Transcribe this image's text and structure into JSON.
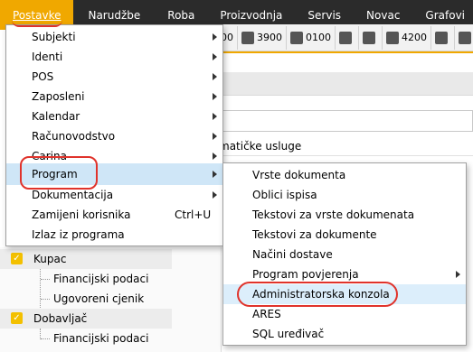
{
  "menubar": {
    "items": [
      {
        "label": "Postavke"
      },
      {
        "label": "Narudžbe"
      },
      {
        "label": "Roba"
      },
      {
        "label": "Proizvodnja"
      },
      {
        "label": "Servis"
      },
      {
        "label": "Novac"
      },
      {
        "label": "Grafovi"
      }
    ]
  },
  "toolbar": {
    "items": [
      {
        "label": "00"
      },
      {
        "label": "3900"
      },
      {
        "label": "0100"
      },
      {
        "label": "4200"
      }
    ]
  },
  "background": {
    "field_text": "matičke usluge"
  },
  "tree": {
    "kupac": "Kupac",
    "kupac_children": [
      "Financijski podaci",
      "Ugovoreni cjenik"
    ],
    "dobavljac": "Dobavljač",
    "dobavljac_children": [
      "Financijski podaci"
    ]
  },
  "main_menu": {
    "items": [
      {
        "label": "Subjekti"
      },
      {
        "label": "Identi"
      },
      {
        "label": "POS"
      },
      {
        "label": "Zaposleni"
      },
      {
        "label": "Kalendar"
      },
      {
        "label": "Računovodstvo"
      },
      {
        "label": "Carina"
      },
      {
        "label": "Program"
      },
      {
        "label": "Dokumentacija"
      },
      {
        "label": "Zamijeni korisnika",
        "shortcut": "Ctrl+U"
      },
      {
        "label": "Izlaz iz programa"
      }
    ]
  },
  "sub_menu": {
    "items": [
      {
        "label": "Vrste dokumenta"
      },
      {
        "label": "Oblici ispisa"
      },
      {
        "label": "Tekstovi za vrste dokumenata"
      },
      {
        "label": "Tekstovi za dokumente"
      },
      {
        "label": "Načini dostave"
      },
      {
        "label": "Program povjerenja"
      },
      {
        "label": "Administratorska konzola"
      },
      {
        "label": "ARES"
      },
      {
        "label": "SQL uređivač"
      }
    ]
  },
  "colors": {
    "accent": "#f0a800",
    "menubar_bg": "#2b2b2b",
    "highlight": "#cfe6f7",
    "annotation": "#e0332b"
  }
}
